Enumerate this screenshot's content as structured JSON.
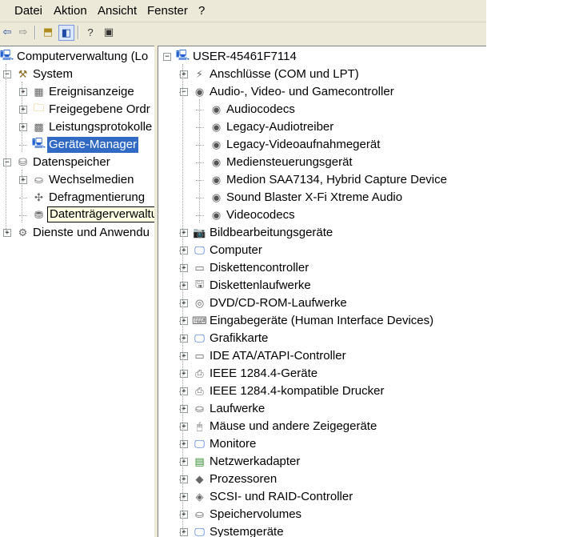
{
  "menu": [
    "Datei",
    "Aktion",
    "Ansicht",
    "Fenster",
    "?"
  ],
  "left_tree": [
    {
      "label": "Computerverwaltung (Lo",
      "level": 0,
      "expander": "",
      "icon": "computer-icon",
      "glyph": "🖳"
    },
    {
      "label": "System",
      "level": 1,
      "expander": "−",
      "icon": "tools-icon",
      "glyph": "⚒"
    },
    {
      "label": "Ereignisanzeige",
      "level": 2,
      "expander": "+",
      "icon": "event-viewer-icon",
      "glyph": "▦"
    },
    {
      "label": "Freigegebene Ordr",
      "level": 2,
      "expander": "+",
      "icon": "shared-folder-icon",
      "glyph": "🗀"
    },
    {
      "label": "Leistungsprotokolle",
      "level": 2,
      "expander": "+",
      "icon": "performance-icon",
      "glyph": "▩"
    },
    {
      "label": "Geräte-Manager",
      "level": 2,
      "expander": "",
      "icon": "device-manager-icon",
      "glyph": "🖳",
      "selected": true
    },
    {
      "label": "Datenspeicher",
      "level": 1,
      "expander": "−",
      "icon": "storage-icon",
      "glyph": "⛁"
    },
    {
      "label": "Wechselmedien",
      "level": 2,
      "expander": "+",
      "icon": "removable-media-icon",
      "glyph": "⛀"
    },
    {
      "label": "Defragmentierung",
      "level": 2,
      "expander": "",
      "icon": "defrag-icon",
      "glyph": "✣"
    },
    {
      "label": "Datenträgerverwaltung",
      "level": 2,
      "expander": "",
      "icon": "disk-management-icon",
      "glyph": "⛃",
      "tooltip": true
    },
    {
      "label": "Dienste und Anwendu",
      "level": 1,
      "expander": "+",
      "icon": "services-icon",
      "glyph": "⚙"
    }
  ],
  "right_tree": [
    {
      "label": "USER-45461F7114",
      "level": 0,
      "expander": "−",
      "icon": "computer-icon",
      "glyph": "🖳"
    },
    {
      "label": "Anschlüsse (COM und LPT)",
      "level": 1,
      "expander": "+",
      "icon": "port-icon",
      "glyph": "⚡"
    },
    {
      "label": "Audio-, Video- und Gamecontroller",
      "level": 1,
      "expander": "−",
      "icon": "speaker-icon",
      "glyph": "◉"
    },
    {
      "label": "Audiocodecs",
      "level": 2,
      "expander": "",
      "icon": "speaker-icon",
      "glyph": "◉"
    },
    {
      "label": "Legacy-Audiotreiber",
      "level": 2,
      "expander": "",
      "icon": "speaker-icon",
      "glyph": "◉"
    },
    {
      "label": "Legacy-Videoaufnahmegerät",
      "level": 2,
      "expander": "",
      "icon": "speaker-icon",
      "glyph": "◉"
    },
    {
      "label": "Mediensteuerungsgerät",
      "level": 2,
      "expander": "",
      "icon": "speaker-icon",
      "glyph": "◉"
    },
    {
      "label": "Medion SAA7134, Hybrid Capture Device",
      "level": 2,
      "expander": "",
      "icon": "speaker-icon",
      "glyph": "◉"
    },
    {
      "label": "Sound Blaster X-Fi Xtreme Audio",
      "level": 2,
      "expander": "",
      "icon": "speaker-icon",
      "glyph": "◉"
    },
    {
      "label": "Videocodecs",
      "level": 2,
      "expander": "",
      "icon": "speaker-icon",
      "glyph": "◉"
    },
    {
      "label": "Bildbearbeitungsgeräte",
      "level": 1,
      "expander": "+",
      "icon": "camera-icon",
      "glyph": "📷"
    },
    {
      "label": "Computer",
      "level": 1,
      "expander": "+",
      "icon": "monitor-icon",
      "glyph": "🖵"
    },
    {
      "label": "Diskettencontroller",
      "level": 1,
      "expander": "+",
      "icon": "controller-icon",
      "glyph": "▭"
    },
    {
      "label": "Diskettenlaufwerke",
      "level": 1,
      "expander": "+",
      "icon": "floppy-icon",
      "glyph": "🖫"
    },
    {
      "label": "DVD/CD-ROM-Laufwerke",
      "level": 1,
      "expander": "+",
      "icon": "cd-icon",
      "glyph": "◎"
    },
    {
      "label": "Eingabegeräte (Human Interface Devices)",
      "level": 1,
      "expander": "+",
      "icon": "keyboard-icon",
      "glyph": "⌨"
    },
    {
      "label": "Grafikkarte",
      "level": 1,
      "expander": "+",
      "icon": "monitor-icon",
      "glyph": "🖵"
    },
    {
      "label": "IDE ATA/ATAPI-Controller",
      "level": 1,
      "expander": "+",
      "icon": "controller-icon",
      "glyph": "▭"
    },
    {
      "label": "IEEE 1284.4-Geräte",
      "level": 1,
      "expander": "+",
      "icon": "printer-icon",
      "glyph": "⎙"
    },
    {
      "label": "IEEE 1284.4-kompatible Drucker",
      "level": 1,
      "expander": "+",
      "icon": "printer-icon",
      "glyph": "⎙"
    },
    {
      "label": "Laufwerke",
      "level": 1,
      "expander": "+",
      "icon": "drive-icon",
      "glyph": "⛀"
    },
    {
      "label": "Mäuse und andere Zeigegeräte",
      "level": 1,
      "expander": "+",
      "icon": "mouse-icon",
      "glyph": "🖰"
    },
    {
      "label": "Monitore",
      "level": 1,
      "expander": "+",
      "icon": "monitor-icon",
      "glyph": "🖵"
    },
    {
      "label": "Netzwerkadapter",
      "level": 1,
      "expander": "+",
      "icon": "network-card-icon",
      "glyph": "▤"
    },
    {
      "label": "Prozessoren",
      "level": 1,
      "expander": "+",
      "icon": "processor-icon",
      "glyph": "◆"
    },
    {
      "label": "SCSI- und RAID-Controller",
      "level": 1,
      "expander": "+",
      "icon": "scsi-icon",
      "glyph": "◈"
    },
    {
      "label": "Speichervolumes",
      "level": 1,
      "expander": "+",
      "icon": "drive-icon",
      "glyph": "⛀"
    },
    {
      "label": "Systemgeräte",
      "level": 1,
      "expander": "+",
      "icon": "monitor-icon",
      "glyph": "🖵"
    }
  ]
}
